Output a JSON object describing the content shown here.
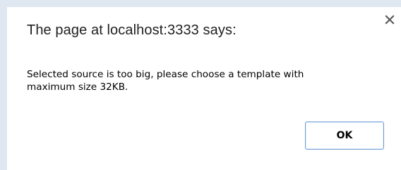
{
  "dialog": {
    "title": "The page at localhost:3333 says:",
    "message": "Selected source is too big, please choose a template with maximum size 32KB.",
    "ok_label": "OK",
    "close_icon": "close-icon"
  },
  "colors": {
    "backdrop": "#dfe7f1",
    "dialog_background": "#ffffff",
    "button_border": "#6f9bd5",
    "text": "#000000"
  }
}
